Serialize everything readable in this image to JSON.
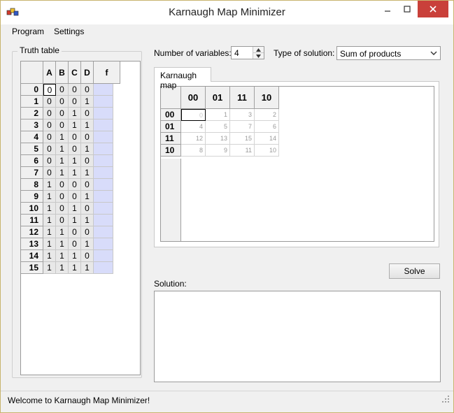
{
  "window": {
    "title": "Karnaugh Map Minimizer",
    "icon": "app-icon",
    "controls": [
      "minimize-icon",
      "maximize-icon",
      "close-icon"
    ]
  },
  "menu": {
    "program": "Program",
    "settings": "Settings"
  },
  "truth_table": {
    "group_label": "Truth table",
    "headers": [
      "A",
      "B",
      "C",
      "D",
      "f"
    ],
    "rows": [
      {
        "index": "0",
        "bits": [
          "0",
          "0",
          "0",
          "0"
        ]
      },
      {
        "index": "1",
        "bits": [
          "0",
          "0",
          "0",
          "1"
        ]
      },
      {
        "index": "2",
        "bits": [
          "0",
          "0",
          "1",
          "0"
        ]
      },
      {
        "index": "3",
        "bits": [
          "0",
          "0",
          "1",
          "1"
        ]
      },
      {
        "index": "4",
        "bits": [
          "0",
          "1",
          "0",
          "0"
        ]
      },
      {
        "index": "5",
        "bits": [
          "0",
          "1",
          "0",
          "1"
        ]
      },
      {
        "index": "6",
        "bits": [
          "0",
          "1",
          "1",
          "0"
        ]
      },
      {
        "index": "7",
        "bits": [
          "0",
          "1",
          "1",
          "1"
        ]
      },
      {
        "index": "8",
        "bits": [
          "1",
          "0",
          "0",
          "0"
        ]
      },
      {
        "index": "9",
        "bits": [
          "1",
          "0",
          "0",
          "1"
        ]
      },
      {
        "index": "10",
        "bits": [
          "1",
          "0",
          "1",
          "0"
        ]
      },
      {
        "index": "11",
        "bits": [
          "1",
          "0",
          "1",
          "1"
        ]
      },
      {
        "index": "12",
        "bits": [
          "1",
          "1",
          "0",
          "0"
        ]
      },
      {
        "index": "13",
        "bits": [
          "1",
          "1",
          "0",
          "1"
        ]
      },
      {
        "index": "14",
        "bits": [
          "1",
          "1",
          "1",
          "0"
        ]
      },
      {
        "index": "15",
        "bits": [
          "1",
          "1",
          "1",
          "1"
        ]
      }
    ]
  },
  "options": {
    "num_vars_label": "Number of variables:",
    "num_vars_value": "4",
    "solution_type_label": "Type of solution:",
    "solution_type_value": "Sum of products"
  },
  "kmap": {
    "tab_label": "Karnaugh map",
    "col_headers": [
      "00",
      "01",
      "11",
      "10"
    ],
    "row_headers": [
      "00",
      "01",
      "11",
      "10"
    ],
    "cells": [
      [
        "0",
        "1",
        "3",
        "2"
      ],
      [
        "4",
        "5",
        "7",
        "6"
      ],
      [
        "12",
        "13",
        "15",
        "14"
      ],
      [
        "8",
        "9",
        "11",
        "10"
      ]
    ]
  },
  "solve_label": "Solve",
  "solution_label": "Solution:",
  "status": "Welcome to Karnaugh Map Minimizer!",
  "colors": {
    "f_column": "#d8dcfa",
    "close_button": "#c9403a"
  }
}
